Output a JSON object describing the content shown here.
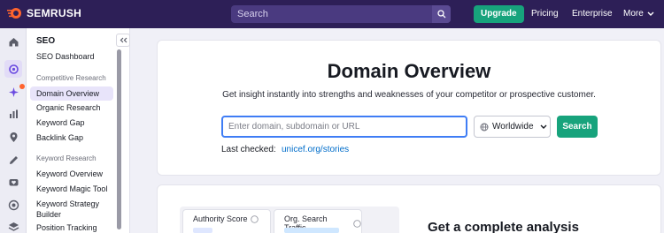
{
  "topbar": {
    "logo_text": "SEMRUSH",
    "search_placeholder": "Search",
    "upgrade_label": "Upgrade",
    "pricing_label": "Pricing",
    "enterprise_label": "Enterprise",
    "more_label": "More"
  },
  "sidebar": {
    "title": "SEO",
    "dashboard": "SEO Dashboard",
    "group_competitive": "Competitive Research",
    "items_competitive": [
      "Domain Overview",
      "Organic Research",
      "Keyword Gap",
      "Backlink Gap"
    ],
    "group_keyword": "Keyword Research",
    "items_keyword": [
      "Keyword Overview",
      "Keyword Magic Tool",
      "Keyword Strategy Builder",
      "Position Tracking"
    ],
    "active_item": "Domain Overview"
  },
  "main": {
    "title": "Domain Overview",
    "subtitle": "Get insight instantly into strengths and weaknesses of your competitor or prospective customer.",
    "input_placeholder": "Enter domain, subdomain or URL",
    "database_label": "Worldwide",
    "search_label": "Search",
    "last_checked_label": "Last checked:",
    "last_checked_link": "unicef.org/stories"
  },
  "preview": {
    "authority_label": "Authority Score",
    "traffic_label": "Org. Search Traffic",
    "complete_heading": "Get a complete analysis"
  },
  "colors": {
    "topbar": "#2d1f57",
    "accent_green": "#17a37c",
    "link_blue": "#006dca",
    "input_focus": "#3f7df5",
    "notification": "#ff642d"
  }
}
